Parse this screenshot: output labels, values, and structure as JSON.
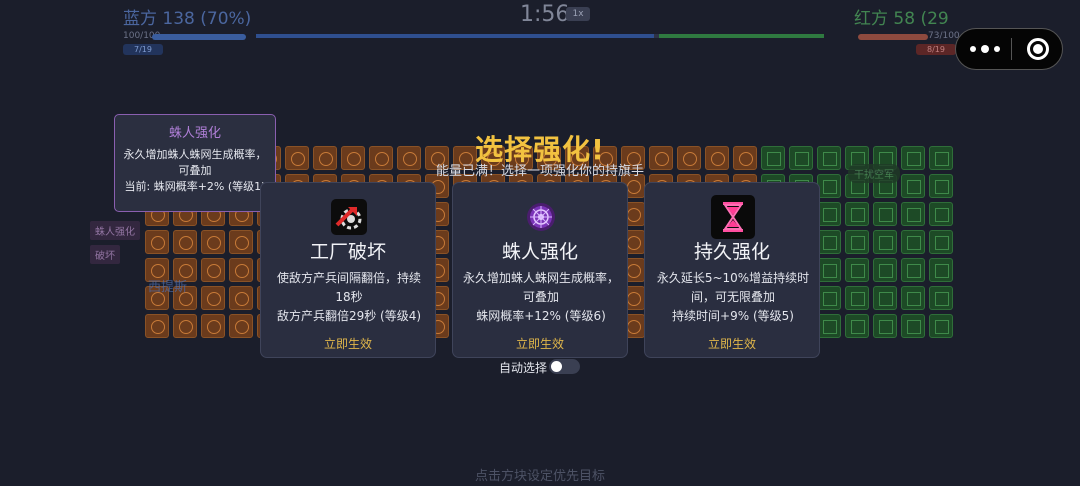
{
  "hud": {
    "blue_label": "蓝方 138 (70%)",
    "red_label": "红方 58 (29",
    "timer": "1:56",
    "speed": "1x",
    "blue_hp": "100/100",
    "blue_wave": "7/19",
    "red_hp": "73/100",
    "red_wave": "8/19",
    "blue_progress": 0.7,
    "red_progress": 0.29
  },
  "board": {
    "left_tags": [
      "蛛人强化",
      "破坏"
    ],
    "blue_side_tag": "西提斯",
    "green_side_tag": "干扰空军"
  },
  "tooltip": {
    "title": "蛛人强化",
    "desc": "永久增加蛛人蛛网生成概率，可叠加",
    "current": "当前: 蛛网概率+2% (等级1)"
  },
  "modal": {
    "title": "选择强化!",
    "subtitle": "能量已满！选择一项强化你的持旗手",
    "cards": [
      {
        "icon": "factory-destroy-icon",
        "name": "工厂破坏",
        "desc": "使敌方产兵间隔翻倍，持续18秒",
        "detail": "敌方产兵翻倍29秒 (等级4)",
        "apply": "立即生效"
      },
      {
        "icon": "spider-web-icon",
        "name": "蛛人强化",
        "desc": "永久增加蛛人蛛网生成概率，可叠加",
        "detail": "蛛网概率+12% (等级6)",
        "apply": "立即生效"
      },
      {
        "icon": "hourglass-icon",
        "name": "持久强化",
        "desc": "永久延长5~10%增益持续时间，可无限叠加",
        "detail": "持续时间+9% (等级5)",
        "apply": "立即生效"
      }
    ],
    "auto_select_label": "自动选择",
    "auto_select_on": false
  },
  "bottom_hint": "点击方块设定优先目标",
  "colors": {
    "accent": "#f2c240",
    "blue_team": "#2f4f8f",
    "green_team": "#2f7a40",
    "card_bg": "#2a2e40"
  }
}
